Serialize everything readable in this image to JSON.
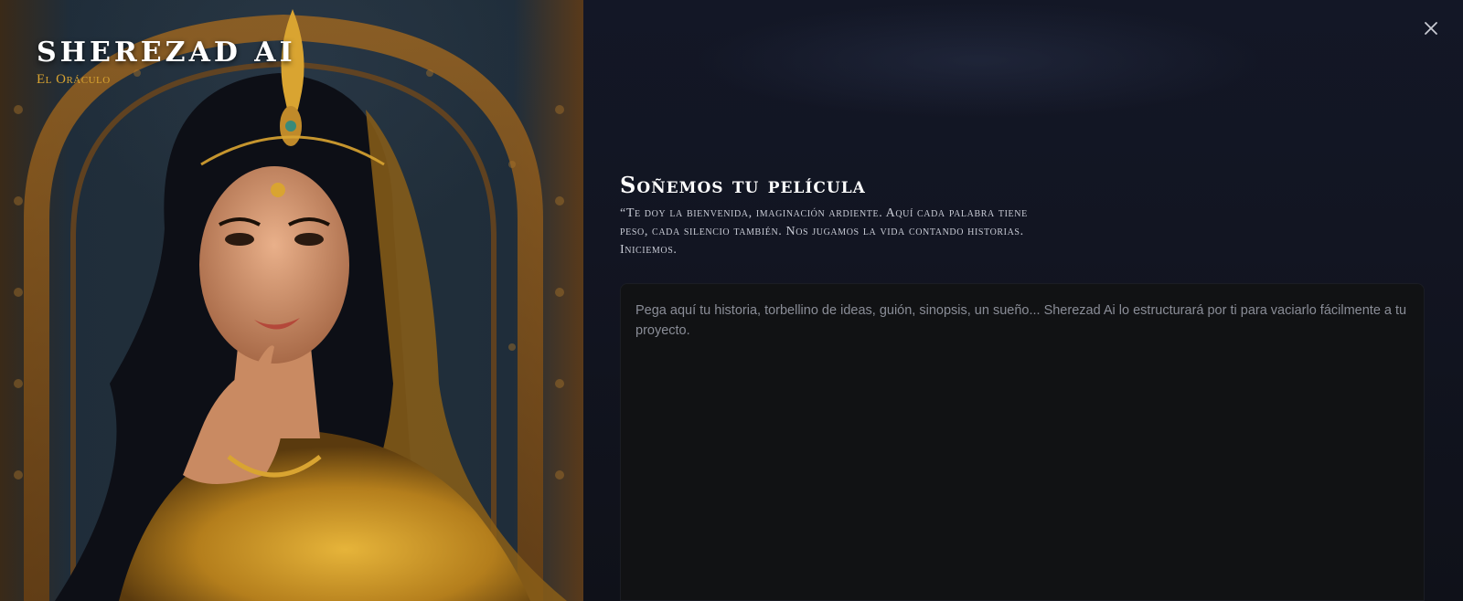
{
  "brand": {
    "title": "SHEREZAD AI",
    "subtitle": "El Oráculo"
  },
  "portrait": {
    "icon": "portrait-image",
    "description_colors": {
      "gold": "#d9a431",
      "robe": "#b8860b",
      "background": "#23303a"
    }
  },
  "close": {
    "icon": "close-icon"
  },
  "main": {
    "heading": "Soñemos tu película",
    "intro": "“Te doy la bienvenida, imaginación ardiente. Aquí cada palabra tiene peso, cada silencio también. Nos jugamos la vida contando historias. Iniciemos.",
    "story_input": {
      "value": "",
      "placeholder": "Pega aquí tu historia, torbellino de ideas, guión, sinopsis, un sueño... Sherezad Ai lo estructurará por ti para vaciarlo fácilmente a tu proyecto."
    }
  },
  "colors": {
    "accent": "#d9a431",
    "panel_bg": "#121522",
    "input_bg": "#111214"
  }
}
